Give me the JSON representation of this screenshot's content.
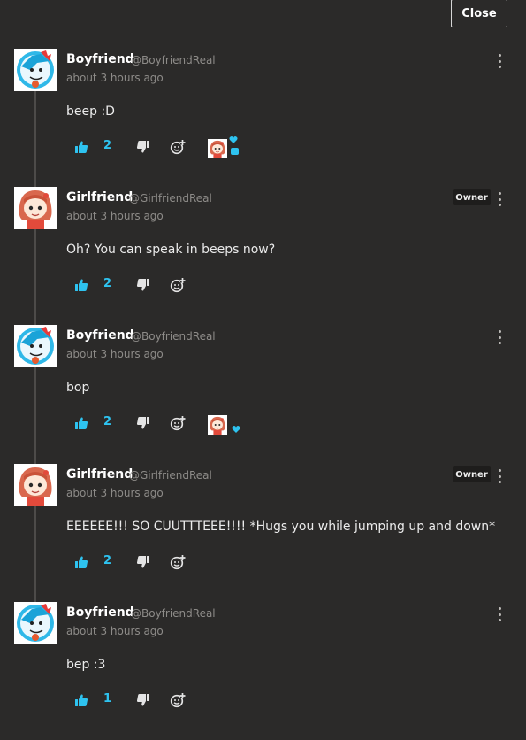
{
  "close_label": "Close",
  "accent_color": "#2ec3f0",
  "comments": [
    {
      "name": "Boyfriend",
      "handle": "@BoyfriendReal",
      "time": "about 3 hours ago",
      "body": "beep :D",
      "likes": "2",
      "avatar": "boyfriend-avatar",
      "reaction": "girlfriend-heart-bubble"
    },
    {
      "name": "Girlfriend",
      "handle": "@GirlfriendReal",
      "time": "about 3 hours ago",
      "body": "Oh? You can speak in beeps now?",
      "likes": "2",
      "badge": "Owner",
      "avatar": "girlfriend-avatar"
    },
    {
      "name": "Boyfriend",
      "handle": "@BoyfriendReal",
      "time": "about 3 hours ago",
      "body": "bop",
      "likes": "2",
      "avatar": "boyfriend-avatar",
      "reaction": "girlfriend-heart"
    },
    {
      "name": "Girlfriend",
      "handle": "@GirlfriendReal",
      "time": "about 3 hours ago",
      "body": "EEEEEE!!! SO CUUTTTEEE!!!! *Hugs you while jumping up and down*",
      "likes": "2",
      "badge": "Owner",
      "avatar": "girlfriend-avatar"
    },
    {
      "name": "Boyfriend",
      "handle": "@BoyfriendReal",
      "time": "about 3 hours ago",
      "body": "bep :3",
      "likes": "1",
      "avatar": "boyfriend-avatar"
    }
  ]
}
